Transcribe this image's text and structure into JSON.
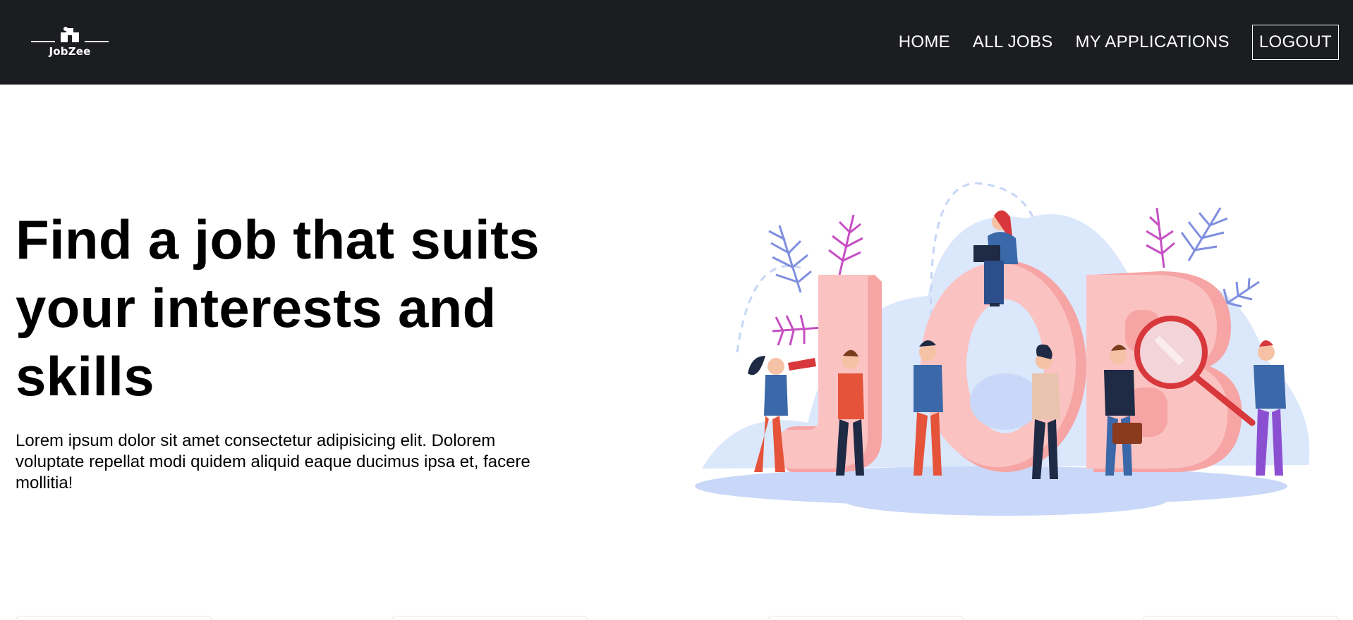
{
  "brand": {
    "name": "JobZee"
  },
  "nav": {
    "links": [
      {
        "label": "HOME"
      },
      {
        "label": "ALL JOBS"
      },
      {
        "label": "MY APPLICATIONS"
      }
    ],
    "logout_label": "LOGOUT"
  },
  "hero": {
    "title": "Find a job that suits your interests and skills",
    "description": "Lorem ipsum dolor sit amet consectetur adipisicing elit. Dolorem voluptate repellat modi quidem aliquid eaque ducimus ipsa et, facere mollitia!",
    "illustration_text": "JOB"
  },
  "colors": {
    "navbar_bg": "#1c1d20",
    "nav_text": "#ffffff",
    "letter_pink": "#f8b4b4",
    "blob_blue": "#dbe7fb"
  }
}
